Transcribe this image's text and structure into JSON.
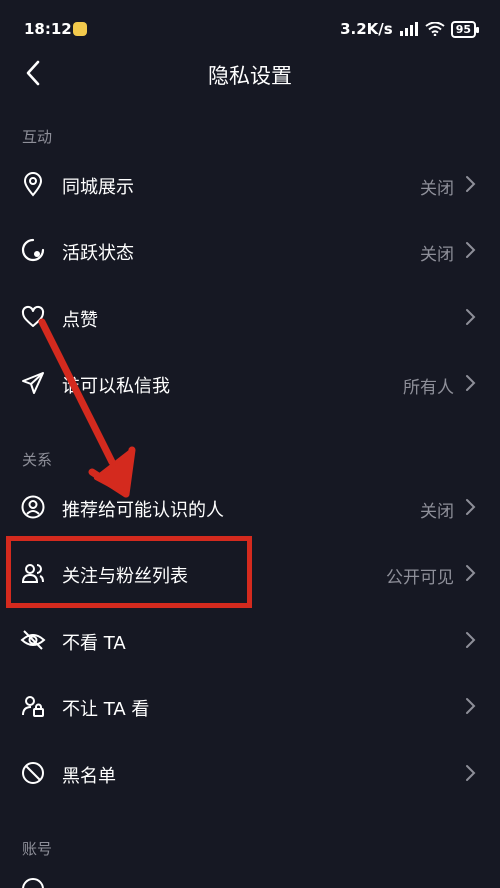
{
  "status_bar": {
    "time": "18:12",
    "network_speed": "3.2K/s",
    "battery": "95"
  },
  "header": {
    "title": "隐私设置"
  },
  "sections": {
    "interaction": "互动",
    "relations": "关系",
    "account": "账号"
  },
  "rows": {
    "city_display": {
      "label": "同城展示",
      "value": "关闭"
    },
    "active_status": {
      "label": "活跃状态",
      "value": "关闭"
    },
    "likes": {
      "label": "点赞",
      "value": ""
    },
    "who_can_dm": {
      "label": "谁可以私信我",
      "value": "所有人"
    },
    "recommend": {
      "label": "推荐给可能认识的人",
      "value": "关闭"
    },
    "follow_list": {
      "label": "关注与粉丝列表",
      "value": "公开可见"
    },
    "dont_see": {
      "label": "不看 TA",
      "value": ""
    },
    "hide_from": {
      "label": "不让 TA 看",
      "value": ""
    },
    "blacklist": {
      "label": "黑名单",
      "value": ""
    }
  },
  "colors": {
    "background": "#161823",
    "secondary_text": "#8e8f99",
    "annotation_red": "#d42a1e"
  }
}
